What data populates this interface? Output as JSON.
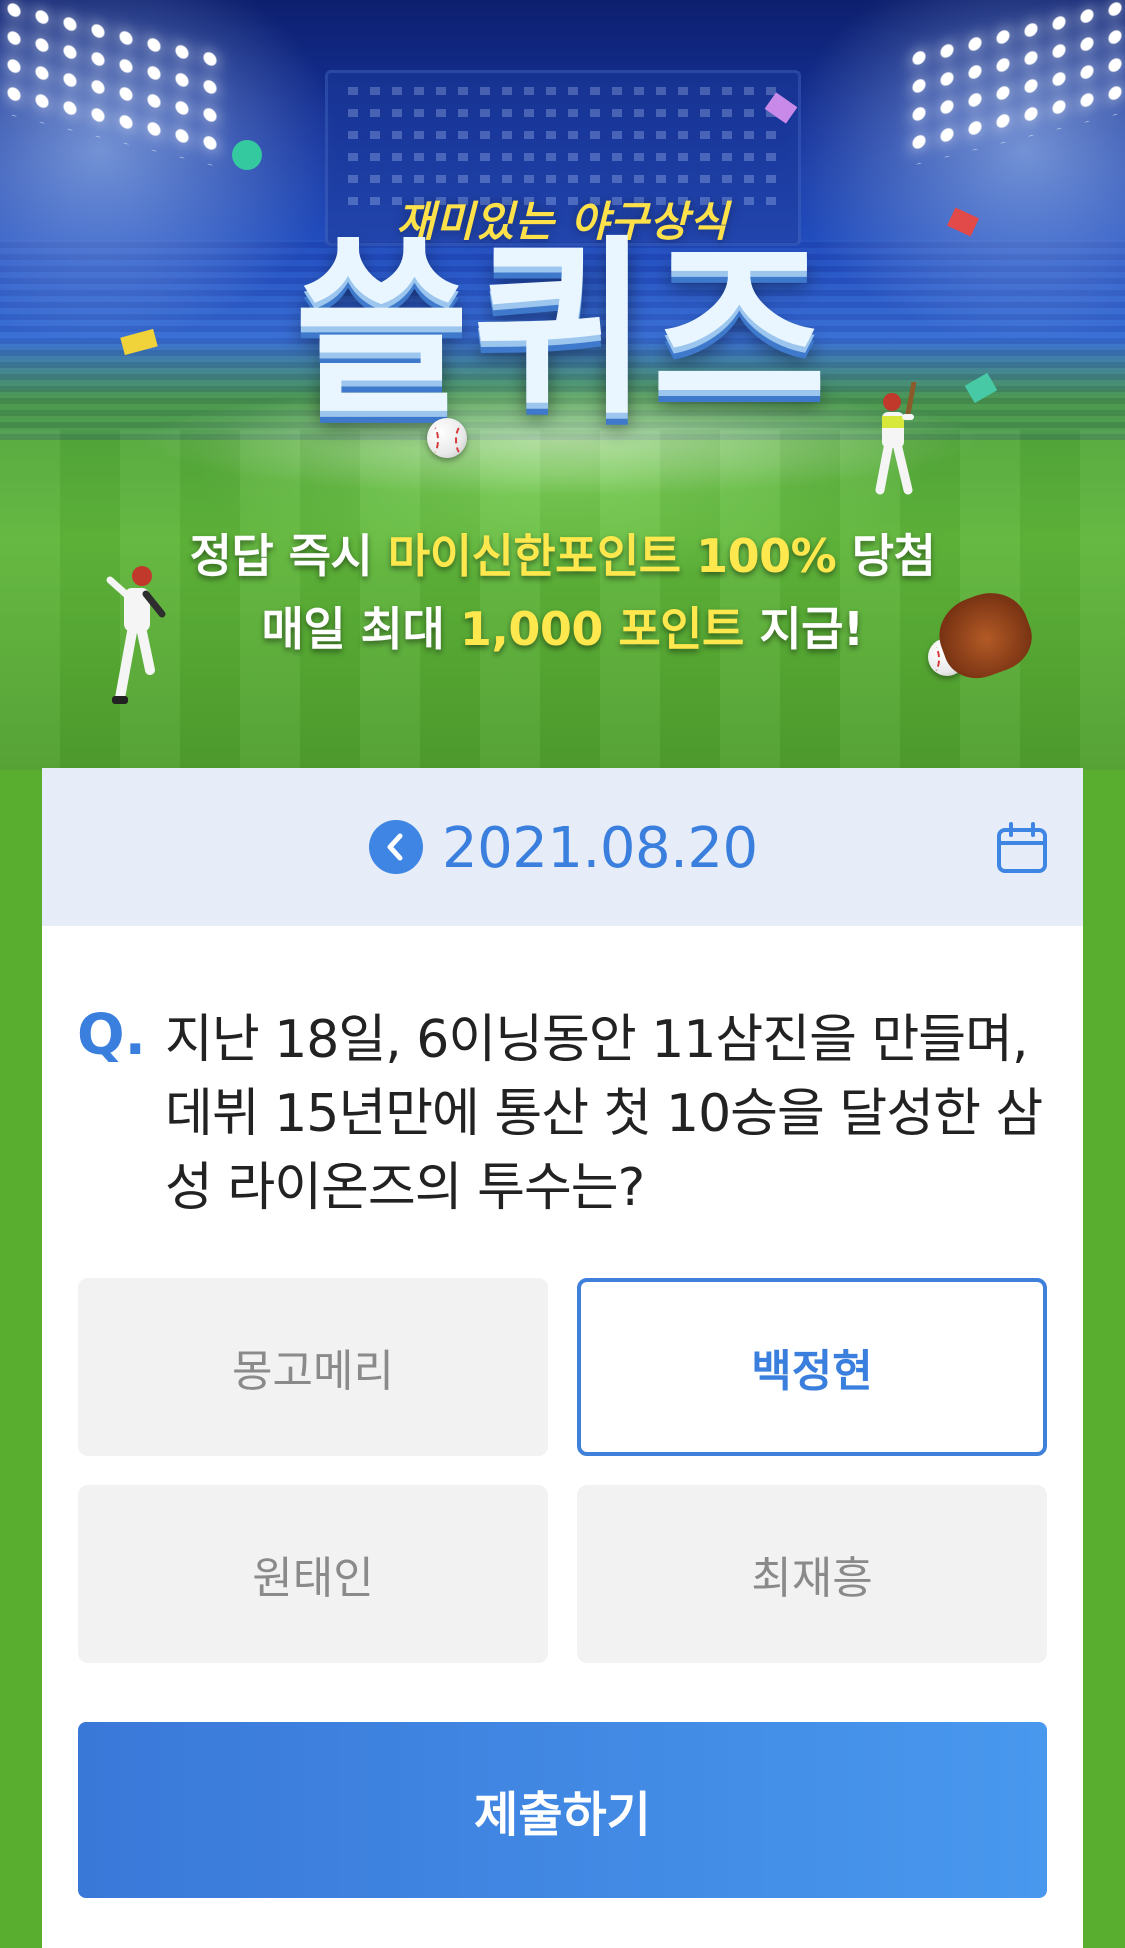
{
  "hero": {
    "subtitle": "재미있는 야구상식",
    "title": "쓸퀴즈",
    "line1_a": "정답 즉시 ",
    "line1_highlight": "마이신한포인트 100%",
    "line1_b": " 당첨",
    "line2_a": "매일 최대 ",
    "line2_highlight": "1,000 포인트",
    "line2_b": " 지급!"
  },
  "date_nav": {
    "date": "2021.08.20",
    "prev_icon": "chevron-left-icon",
    "calendar_icon": "calendar-icon"
  },
  "question": {
    "marker": "Q.",
    "text": "지난 18일, 6이닝동안 11삼진을 만들며, 데뷔 15년만에 통산 첫 10승을 달성한 삼성 라이온즈의 투수는?"
  },
  "options": [
    {
      "label": "몽고메리",
      "selected": false
    },
    {
      "label": "백정현",
      "selected": true
    },
    {
      "label": "원태인",
      "selected": false
    },
    {
      "label": "최재흥",
      "selected": false
    }
  ],
  "submit_label": "제출하기",
  "colors": {
    "accent": "#3a7fdd",
    "highlight_yellow": "#ffe84e",
    "date_bar_bg": "#e6edf8",
    "option_bg": "#f2f2f2",
    "page_green": "#5aae2f"
  }
}
